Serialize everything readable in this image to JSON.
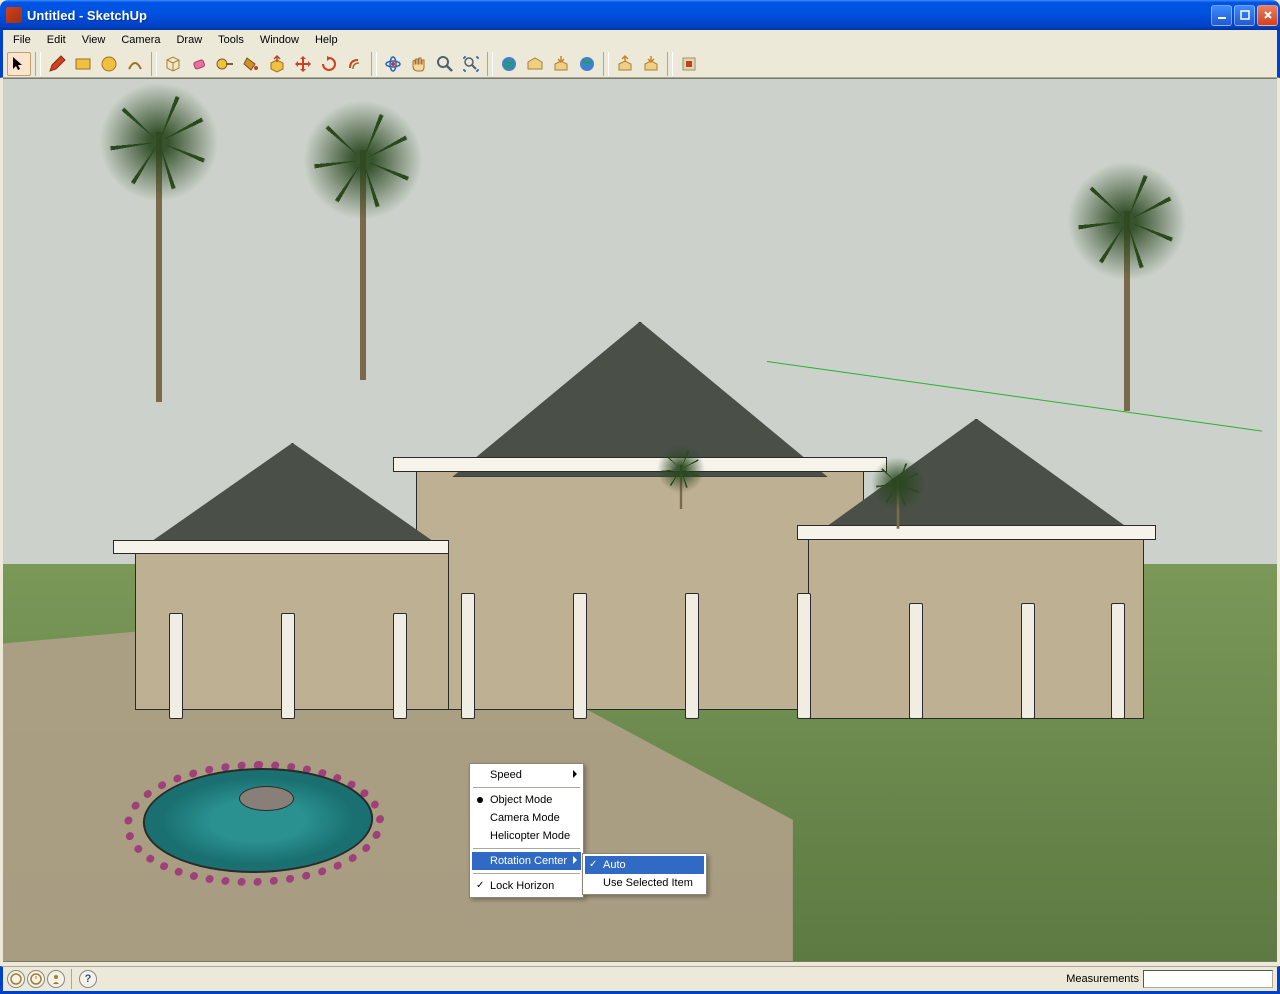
{
  "titlebar": {
    "title": "Untitled - SketchUp"
  },
  "menubar": {
    "items": [
      "File",
      "Edit",
      "View",
      "Camera",
      "Draw",
      "Tools",
      "Window",
      "Help"
    ]
  },
  "context_menu": {
    "items": [
      {
        "label": "Speed",
        "submenu": true
      },
      {
        "label": "Object Mode",
        "radio": true
      },
      {
        "label": "Camera Mode"
      },
      {
        "label": "Helicopter Mode"
      },
      {
        "label": "Rotation Center",
        "submenu": true,
        "highlighted": true
      },
      {
        "label": "Lock Horizon",
        "checked": true
      }
    ],
    "submenu": [
      {
        "label": "Auto",
        "checked": true,
        "highlighted": true
      },
      {
        "label": "Use Selected Item"
      }
    ]
  },
  "statusbar": {
    "measurements_label": "Measurements",
    "measurements_value": ""
  },
  "toolbar": {
    "tools": [
      "select-tool",
      "pencil-tool",
      "rectangle-tool",
      "circle-tool",
      "arc-tool",
      "make-component-tool",
      "eraser-tool",
      "tape-measure-tool",
      "paint-bucket-tool",
      "push-pull-tool",
      "move-tool",
      "rotate-tool",
      "offset-tool",
      "orbit-tool",
      "pan-tool",
      "zoom-tool",
      "zoom-extents-tool",
      "add-location-tool",
      "get-models-tool",
      "share-model-tool",
      "preview-ge-tool",
      "export-tool",
      "import-tool",
      "layers-tool"
    ]
  }
}
